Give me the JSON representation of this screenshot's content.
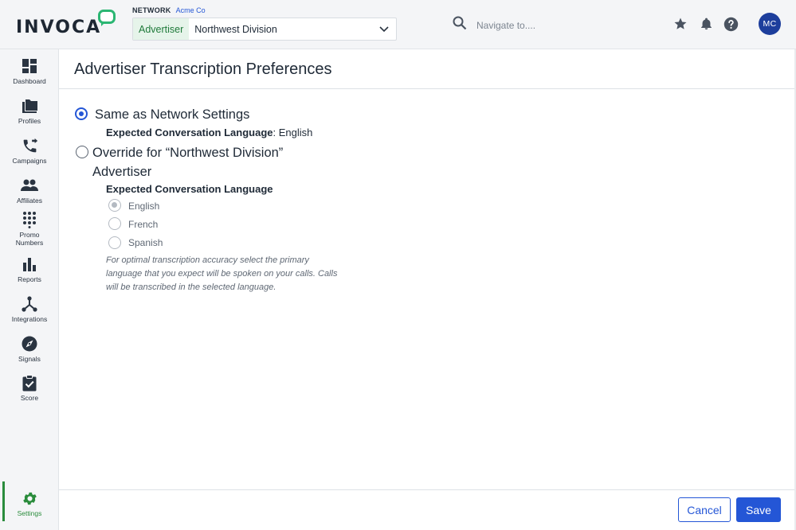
{
  "header": {
    "logo_text": "INVOCA",
    "network_label": "NETWORK",
    "network_value": "Acme Co",
    "advertiser_tag": "Advertiser",
    "advertiser_value": "Northwest Division",
    "search_placeholder": "Navigate to....",
    "user_initials": "MC",
    "icons": [
      "search-icon",
      "star-icon",
      "bell-icon",
      "help-icon"
    ]
  },
  "sidebar": {
    "items": [
      {
        "label": "Dashboard",
        "icon": "dashboard-icon"
      },
      {
        "label": "Profiles",
        "icon": "folder-icon"
      },
      {
        "label": "Campaigns",
        "icon": "phone-forward-icon"
      },
      {
        "label": "Affiliates",
        "icon": "people-icon"
      },
      {
        "label": "Promo",
        "label2": "Numbers",
        "icon": "dialpad-icon"
      },
      {
        "label": "Reports",
        "icon": "bar-chart-icon"
      },
      {
        "label": "Integrations",
        "icon": "hub-icon"
      },
      {
        "label": "Signals",
        "icon": "compass-icon"
      },
      {
        "label": "Score",
        "icon": "clipboard-check-icon"
      },
      {
        "label": "Settings",
        "icon": "gear-icon",
        "active": true
      }
    ],
    "active_color": "#2a8c3c"
  },
  "main": {
    "title": "Advertiser Transcription Preferences",
    "option_same": {
      "label": "Same as Network Settings",
      "selected": true,
      "detail_label": "Expected Conversation Language",
      "detail_sep": ":",
      "detail_value": "English"
    },
    "option_override": {
      "label_line1": "Override for “Northwest Division”",
      "label_line2": "Advertiser",
      "selected": false,
      "sub_heading": "Expected Conversation Language",
      "languages": [
        "English",
        "French",
        "Spanish"
      ],
      "selected_language": "English",
      "help_text": "For optimal transcription accuracy select the primary language that you expect will be spoken on your calls. Calls will be transcribed in the selected language."
    }
  },
  "footer": {
    "cancel_label": "Cancel",
    "save_label": "Save"
  },
  "colors": {
    "primary": "#2456d6",
    "brand_green": "#2bb673",
    "avatar_bg": "#1d3e9c"
  }
}
